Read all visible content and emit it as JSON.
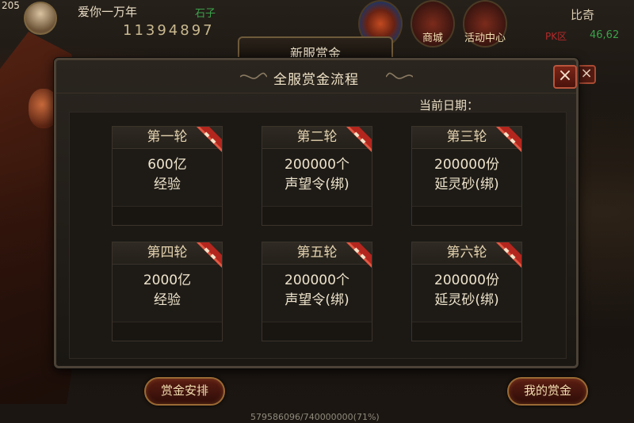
{
  "hud": {
    "level": "205",
    "player_name": "爱你一万年",
    "guild": "石子",
    "power": "11394897",
    "icons": [
      {
        "label": "",
        "icon": "compass-orb-icon"
      },
      {
        "label": "商城",
        "icon": "shop-icon"
      },
      {
        "label": "活动中心",
        "icon": "activity-center-icon"
      }
    ],
    "right_name": "比奇",
    "pk_label": "PK区",
    "coords": "46,62",
    "back_tab": "新服赏金",
    "back_close": "×",
    "exp_text": "579586096/740000000(71%)"
  },
  "dialog": {
    "title": "全服赏金流程",
    "close": "×",
    "date_label": "当前日期：",
    "rounds": [
      {
        "name": "第一轮",
        "line1": "600亿",
        "line2": "经验"
      },
      {
        "name": "第二轮",
        "line1": "200000个",
        "line2": "声望令(绑)"
      },
      {
        "name": "第三轮",
        "line1": "200000份",
        "line2": "延灵砂(绑)"
      },
      {
        "name": "第四轮",
        "line1": "2000亿",
        "line2": "经验"
      },
      {
        "name": "第五轮",
        "line1": "200000个",
        "line2": "声望令(绑)"
      },
      {
        "name": "第六轮",
        "line1": "200000份",
        "line2": "延灵砂(绑)"
      }
    ]
  },
  "buttons": {
    "schedule": "赏金安排",
    "my_bounty": "我的赏金"
  },
  "colors": {
    "accent_red": "#b3261e",
    "gold_text": "#efe2c6",
    "panel_bg": "#1e1b17"
  }
}
